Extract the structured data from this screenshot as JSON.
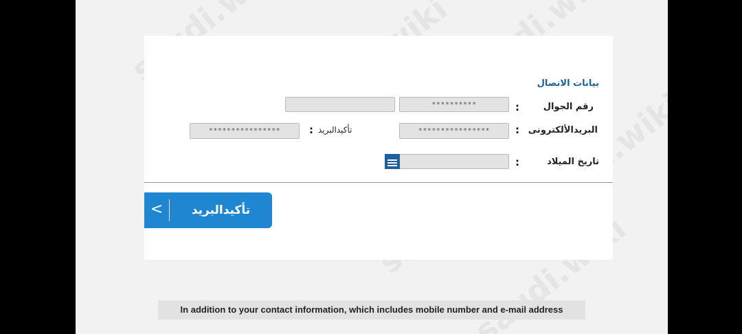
{
  "form": {
    "section_title": "بيانات الاتصال",
    "mobile": {
      "label": "رقم الجوال",
      "colon": ":",
      "value": "**********"
    },
    "email": {
      "label": "البريدالألكترونى",
      "colon": ":",
      "value": "****************"
    },
    "email_confirm": {
      "label": "تأكيدالبريد",
      "colon": ":",
      "value": "****************"
    },
    "birth_date": {
      "label": "تاريخ الميلاد",
      "colon": ":",
      "value": ""
    }
  },
  "confirm_button": {
    "label": "تأكيدالبريد",
    "arrow": "<"
  },
  "caption": "In addition to your contact information, which includes mobile number and e-mail address",
  "watermark": "saudi.wiki",
  "colors": {
    "accent": "#1f86d1",
    "title": "#1a5f9e",
    "field_bg": "#e3e3e3"
  }
}
